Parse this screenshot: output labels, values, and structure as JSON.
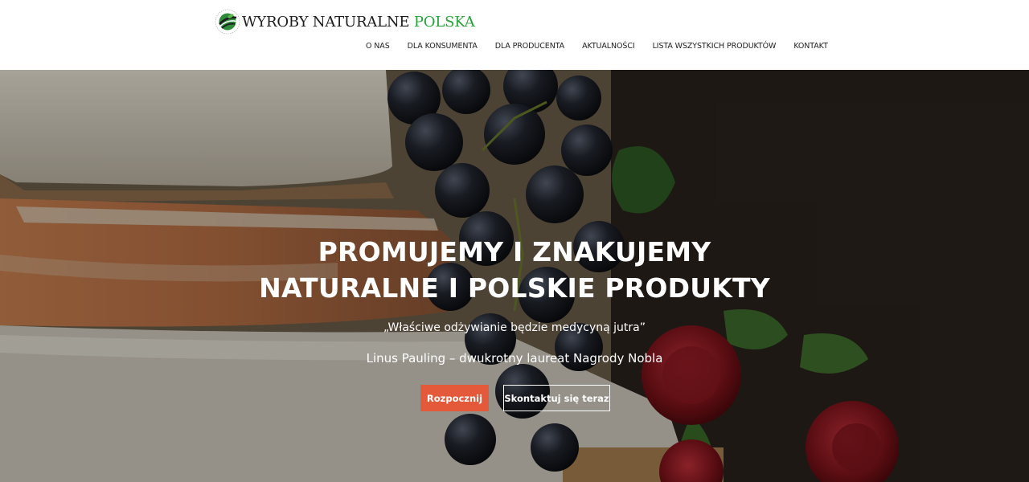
{
  "header": {
    "logo": {
      "text_main": "WYROBY NATURALNE ",
      "text_accent": "POLSKA",
      "accent_color": "#27a23a",
      "icon": "globe-leaf-icon"
    },
    "nav": [
      {
        "label": "O NAS"
      },
      {
        "label": "DLA KONSUMENTA"
      },
      {
        "label": "DLA PRODUCENTA"
      },
      {
        "label": "AKTUALNOŚCI"
      },
      {
        "label": "LISTA WSZYSTKICH PRODUKTÓW"
      },
      {
        "label": "KONTAKT"
      }
    ]
  },
  "hero": {
    "title_line1": "PROMUJEMY I ZNAKUJEMY",
    "title_line2": "NATURALNE I POLSKIE PRODUKTY",
    "quote": "„Właściwe odżywianie będzie medycyną jutra”",
    "author": "Linus Pauling – dwukrotny laureat Nagrody Nobla",
    "primary_button": "Rozpocznij",
    "secondary_button": "Skontaktuj się teraz",
    "primary_color": "#e3593a"
  }
}
